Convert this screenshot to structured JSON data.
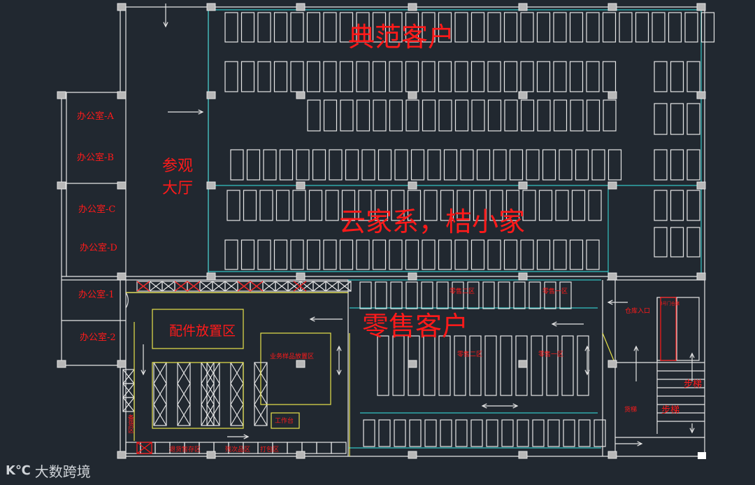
{
  "zones": {
    "typical_clients": "典范客户",
    "yunjia": "云家系，桔小家",
    "retail": "零售客户",
    "parts_area": "配件放置区",
    "visit_hall": "参观\n大厅",
    "office_a": "办公室-A",
    "office_b": "办公室-B",
    "office_c": "办公室-C",
    "office_d": "办公室-D",
    "office_1": "办公室-1",
    "office_2": "办公室-2",
    "sample_area": "业务样品放置区",
    "workbench": "工作台",
    "warehouse_entry": "仓库入口",
    "stairs_1": "步梯",
    "stairs_2": "步梯",
    "elevator": "货梯",
    "retail_zone_2": "零售二区",
    "retail_zone_1": "零售一区",
    "retail_row_2": "零售二区",
    "retail_row_1": "零售一区",
    "returns_area": "退货暂存区",
    "defect_area": "残次品区",
    "packing_area": "打包区",
    "side_zone": "备货区",
    "right_panel": "3号门仓储"
  },
  "watermark": {
    "logo": "大数跨境",
    "mark": "K℃"
  },
  "colors": {
    "background": "#212830",
    "wall": "#e6e6e6",
    "cyan": "#33c3c3",
    "yellow": "#e8e34a",
    "red": "#ff1a1a",
    "green": "#2ee04a"
  }
}
